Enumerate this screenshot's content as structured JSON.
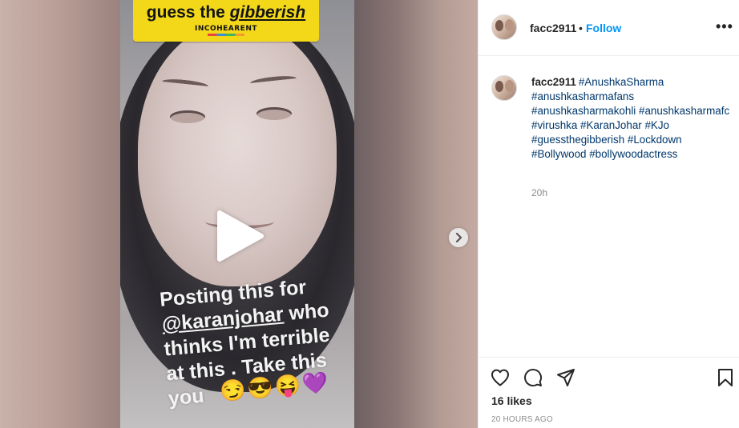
{
  "media": {
    "sticker_title_prefix": "guess the",
    "sticker_title_emph": "gibberish",
    "sticker_brand": "INCOHEARENT",
    "caption_line1": "Posting this for",
    "caption_mention": "@karanjohar",
    "caption_line2_rest": "who",
    "caption_line3": "thinks I'm terrible",
    "caption_line4": "at this . Take this",
    "caption_line5": "you",
    "emojis": "😏😎😝💜",
    "play_icon": "play-icon",
    "next_icon": "chevron-right-icon"
  },
  "header": {
    "username": "facc2911",
    "separator": "•",
    "follow_label": "Follow",
    "more_label": "•••"
  },
  "post": {
    "author": "facc2911",
    "hashtags": [
      "#AnushkaSharma",
      "#anushkasharmafans",
      "#anushkasharmakohli",
      "#anushkasharmafc",
      "#virushka",
      "#KaranJohar",
      "#KJo",
      "#guessthegibberish",
      "#Lockdown",
      "#Bollywood",
      "#bollywoodactress"
    ],
    "time_relative": "20h"
  },
  "actions": {
    "like_icon": "heart-icon",
    "comment_icon": "comment-icon",
    "share_icon": "share-icon",
    "save_icon": "bookmark-icon",
    "likes": "16 likes",
    "time_ago": "20 HOURS AGO"
  },
  "colors": {
    "follow": "#0095f6",
    "hashtag": "#00376b",
    "muted": "#8e8e8e",
    "sticker": "#f3d81a"
  }
}
